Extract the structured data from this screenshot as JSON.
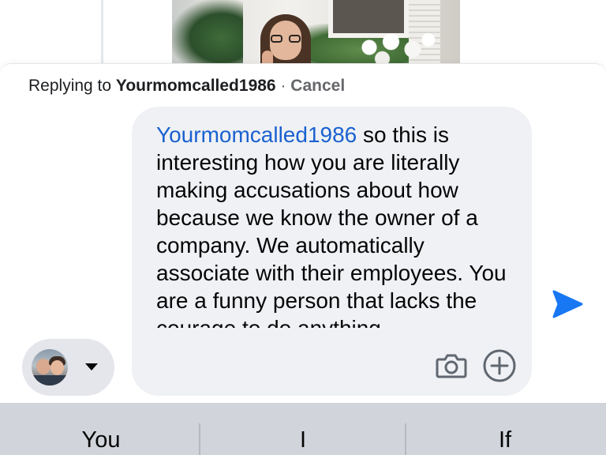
{
  "reply": {
    "prefix": "Replying to",
    "name": "Yourmomcalled1986",
    "separator": "·",
    "cancel": "Cancel"
  },
  "composer": {
    "mention": "Yourmomcalled1986",
    "message": " so this is interesting how you are literally making accusations about how because we know the owner of a company. We automatically associate with their employees. You are a funny person that lacks the courage to do anything",
    "mention_color": "#1a61d0",
    "bubble_color": "#eff1f4"
  },
  "icons": {
    "camera": "camera-icon",
    "add": "plus-circle-icon",
    "send": "send-icon",
    "dropdown": "chevron-down-icon"
  },
  "colors": {
    "send": "#1877f2"
  },
  "keyboard": {
    "suggestions": [
      "You",
      "I",
      "If"
    ]
  }
}
